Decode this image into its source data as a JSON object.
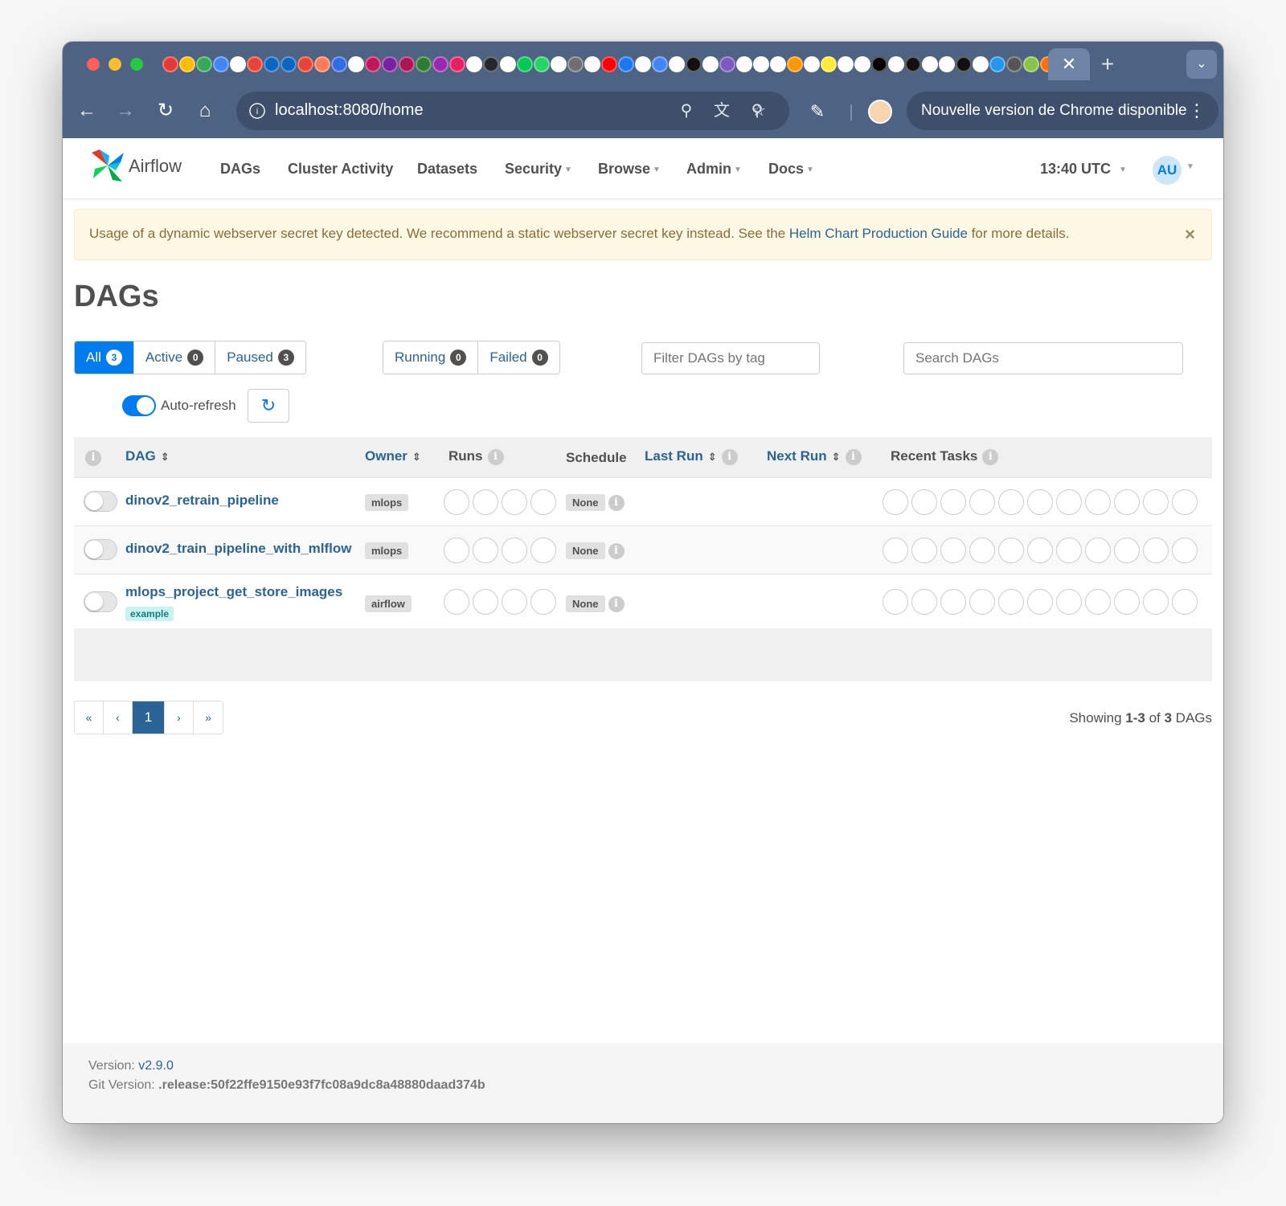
{
  "browser": {
    "url": "localhost:8080/home",
    "update_text": "Nouvelle version de Chrome disponible",
    "tab_close": "✕",
    "new_tab": "+",
    "favicon_colors": [
      "#e53935",
      "#fbbc04",
      "#34a853",
      "#4285f4",
      "#ffffff",
      "#ea4335",
      "#0a66c2",
      "#0a66c2",
      "#ea4335",
      "#ff7a59",
      "#326ce5",
      "#ffffff",
      "#c2185b",
      "#7b1fa2",
      "#ad1457",
      "#2e7d32",
      "#9c27b0",
      "#e91e63",
      "#ffffff",
      "#24292e",
      "#ffffff",
      "#00c853",
      "#25d366",
      "#ffffff",
      "#6e6e6e",
      "#ffffff",
      "#ff0000",
      "#1877f2",
      "#ffffff",
      "#4285f4",
      "#ffffff",
      "#111111",
      "#ffffff",
      "#7e57c2",
      "#ffffff",
      "#ffffff",
      "#ffffff",
      "#ff9800",
      "#ffffff",
      "#ffeb3b",
      "#ffffff",
      "#ffffff",
      "#000000",
      "#ffffff",
      "#111111",
      "#ffffff",
      "#ffffff",
      "#111111",
      "#ffffff",
      "#2496ed",
      "#555555",
      "#8bc34a",
      "#ff6f00",
      "#f57c00",
      "#795548"
    ]
  },
  "nav": {
    "brand": "Airflow",
    "menu": [
      {
        "label": "DAGs",
        "dropdown": false
      },
      {
        "label": "Cluster Activity",
        "dropdown": false
      },
      {
        "label": "Datasets",
        "dropdown": false
      },
      {
        "label": "Security",
        "dropdown": true
      },
      {
        "label": "Browse",
        "dropdown": true
      },
      {
        "label": "Admin",
        "dropdown": true
      },
      {
        "label": "Docs",
        "dropdown": true
      }
    ],
    "clock": "13:40 UTC",
    "avatar": "AU"
  },
  "alert": {
    "text_before": "Usage of a dynamic webserver secret key detected. We recommend a static webserver secret key instead. See the ",
    "link": "Helm Chart Production Guide",
    "text_after": " for more details.",
    "close": "×"
  },
  "page": {
    "title": "DAGs",
    "filters": {
      "all": {
        "label": "All",
        "count": "3"
      },
      "active": {
        "label": "Active",
        "count": "0"
      },
      "paused": {
        "label": "Paused",
        "count": "3"
      },
      "running": {
        "label": "Running",
        "count": "0"
      },
      "failed": {
        "label": "Failed",
        "count": "0"
      }
    },
    "tag_filter_placeholder": "Filter DAGs by tag",
    "search_placeholder": "Search DAGs",
    "auto_refresh_label": "Auto-refresh"
  },
  "table": {
    "headers": {
      "dag": "DAG",
      "owner": "Owner",
      "runs": "Runs",
      "schedule": "Schedule",
      "last_run": "Last Run",
      "next_run": "Next Run",
      "recent_tasks": "Recent Tasks"
    },
    "rows": [
      {
        "dag_id": "dinov2_retrain_pipeline",
        "owner": "mlops",
        "schedule": "None",
        "tag": ""
      },
      {
        "dag_id": "dinov2_train_pipeline_with_mlflow",
        "owner": "mlops",
        "schedule": "None",
        "tag": ""
      },
      {
        "dag_id": "mlops_project_get_store_images",
        "owner": "airflow",
        "schedule": "None",
        "tag": "example"
      }
    ]
  },
  "pagination": {
    "first": "«",
    "prev": "‹",
    "current": "1",
    "next": "›",
    "last": "»",
    "showing_prefix": "Showing ",
    "showing_range": "1-3",
    "showing_of": " of ",
    "showing_total": "3",
    "showing_suffix": " DAGs"
  },
  "footer": {
    "version_label": "Version: ",
    "version": "v2.9.0",
    "git_label": "Git Version: ",
    "git_version": ".release:50f22ffe9150e93f7fc08a9dc8a48880daad374b"
  }
}
